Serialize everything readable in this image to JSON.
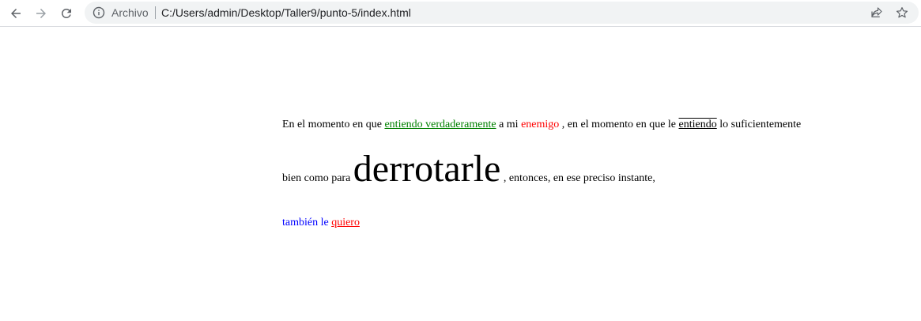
{
  "browser": {
    "scheme_label": "Archivo",
    "url": "C:/Users/admin/Desktop/Taller9/punto-5/index.html",
    "icons": [
      "back-arrow-icon",
      "forward-arrow-icon",
      "reload-icon",
      "info-icon",
      "share-icon",
      "star-icon"
    ]
  },
  "content": {
    "t1": "En el momento en que",
    "link1": "entiendo verdaderamente",
    "t2": "a mi",
    "w_enemigo": "enemigo",
    "t3": ", en el momento en que le",
    "w_entiendo": "entiendo",
    "t4": "lo suficientemente bien como para",
    "w_big": "derrotarle",
    "t5": ", entonces, en ese preciso instante,",
    "w_tambien": "también le",
    "link2": "quiero"
  },
  "colors": {
    "green_link": "#008000",
    "red": "#ff0000",
    "blue": "#0000ff"
  }
}
